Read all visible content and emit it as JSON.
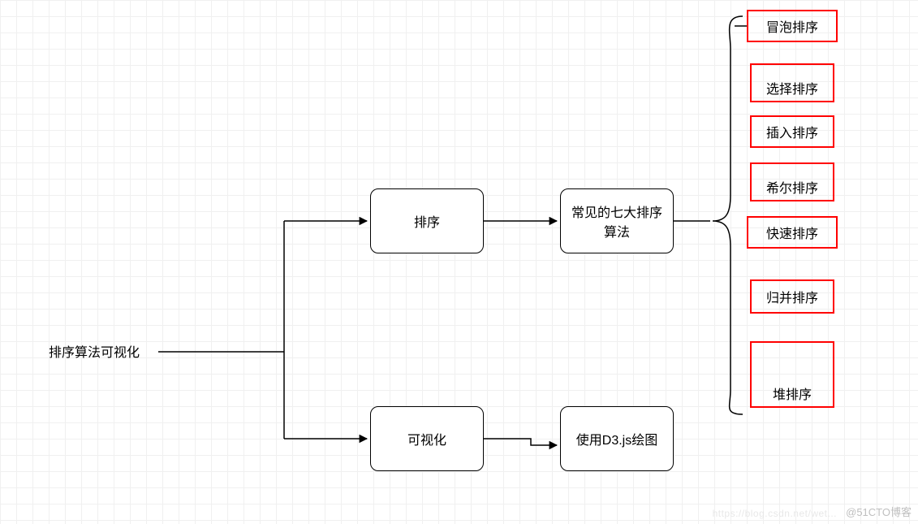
{
  "root": {
    "label": "排序算法可视化"
  },
  "branches": {
    "sort": {
      "label": "排序",
      "result": "常见的七大排序算法",
      "algorithms": [
        "冒泡排序",
        "选择排序",
        "插入排序",
        "希尔排序",
        "快速排序",
        "归并排序",
        "堆排序"
      ]
    },
    "viz": {
      "label": "可视化",
      "result": "使用D3.js绘图"
    }
  },
  "watermark": "@51CTO博客",
  "watermark2": "https://blog.csdn.net/wet..."
}
